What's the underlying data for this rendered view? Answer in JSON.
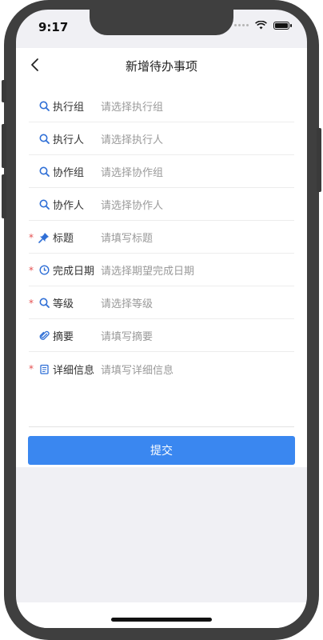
{
  "status": {
    "time": "9:17"
  },
  "nav": {
    "title": "新增待办事项"
  },
  "form": {
    "fields": [
      {
        "label": "执行组",
        "placeholder": "请选择执行组",
        "required": false,
        "icon": "search-icon"
      },
      {
        "label": "执行人",
        "placeholder": "请选择执行人",
        "required": false,
        "icon": "search-icon"
      },
      {
        "label": "协作组",
        "placeholder": "请选择协作组",
        "required": false,
        "icon": "search-icon"
      },
      {
        "label": "协作人",
        "placeholder": "请选择协作人",
        "required": false,
        "icon": "search-icon"
      },
      {
        "label": "标题",
        "placeholder": "请填写标题",
        "required": true,
        "icon": "pin-icon"
      },
      {
        "label": "完成日期",
        "placeholder": "请选择期望完成日期",
        "required": true,
        "icon": "clock-icon"
      },
      {
        "label": "等级",
        "placeholder": "请选择等级",
        "required": true,
        "icon": "search-icon"
      },
      {
        "label": "摘要",
        "placeholder": "请填写摘要",
        "required": false,
        "icon": "paperclip-icon"
      },
      {
        "label": "详细信息",
        "placeholder": "请填写详细信息",
        "required": true,
        "icon": "notepad-icon"
      }
    ],
    "required_mark": "*",
    "submit_label": "提交"
  },
  "colors": {
    "accent": "#3a87f0",
    "icon": "#2f6fd6",
    "required": "#e45050"
  }
}
